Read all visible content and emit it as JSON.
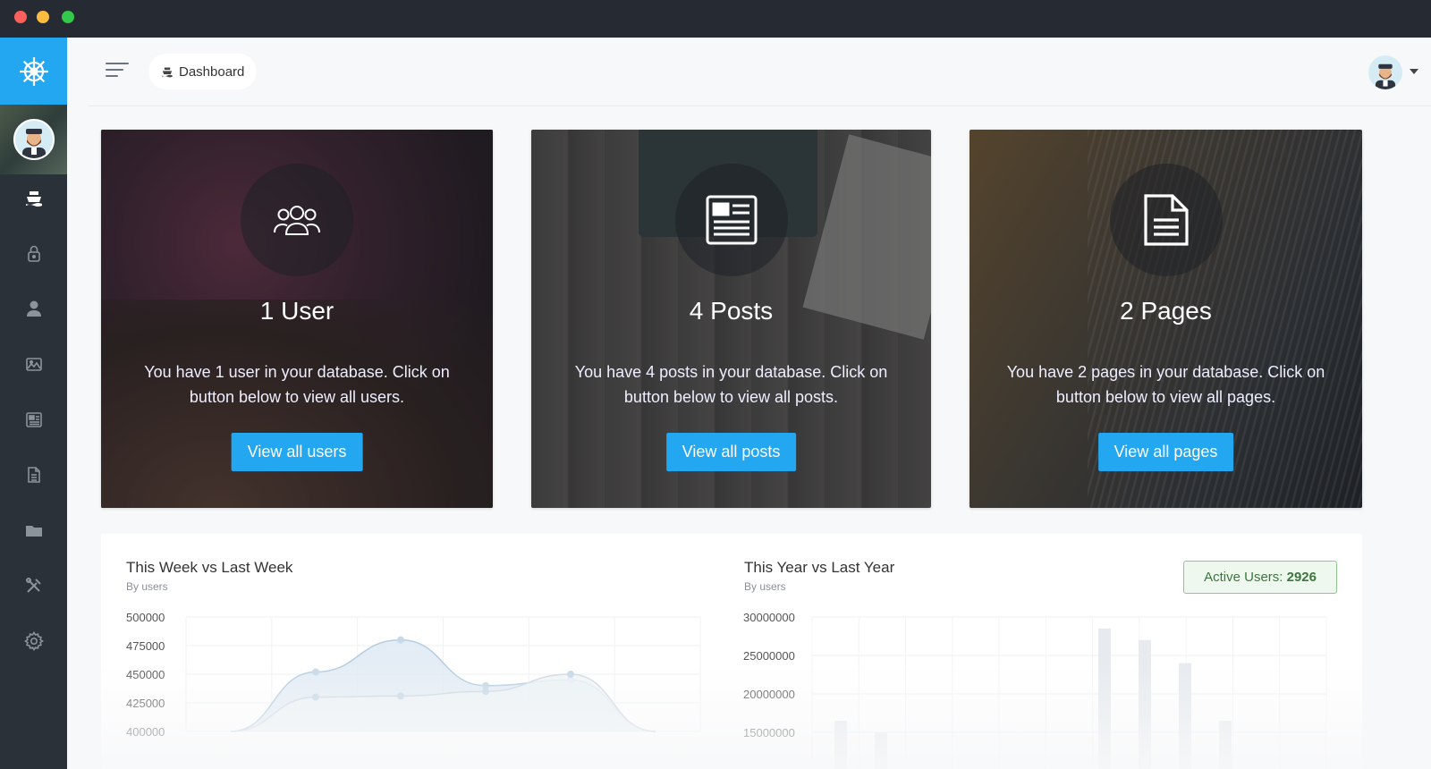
{
  "breadcrumb": {
    "label": "Dashboard"
  },
  "cards": [
    {
      "title": "1 User",
      "description": "You have 1 user in your database. Click on button below to view all users.",
      "button": "View all users"
    },
    {
      "title": "4 Posts",
      "description": "You have 4 posts in your database. Click on button below to view all posts.",
      "button": "View all posts"
    },
    {
      "title": "2 Pages",
      "description": "You have 2 pages in your database. Click on button below to view all pages.",
      "button": "View all pages"
    }
  ],
  "sidebar": {
    "items": [
      {
        "icon": "boat-icon"
      },
      {
        "icon": "lock-icon"
      },
      {
        "icon": "user-icon"
      },
      {
        "icon": "images-icon"
      },
      {
        "icon": "news-icon"
      },
      {
        "icon": "document-icon"
      },
      {
        "icon": "folder-icon"
      },
      {
        "icon": "tools-icon"
      },
      {
        "icon": "gear-icon"
      }
    ]
  },
  "charts": {
    "week": {
      "title": "This Week vs Last Week",
      "subtitle": "By users"
    },
    "year": {
      "title": "This Year vs Last Year",
      "subtitle": "By users"
    },
    "active_users_label": "Active Users:",
    "active_users_value": "2926"
  },
  "chart_data": [
    {
      "type": "area",
      "title": "This Week vs Last Week",
      "ylabel": "",
      "yticks": [
        "500000",
        "475000",
        "450000",
        "425000",
        "400000"
      ],
      "ylim": [
        400000,
        500000
      ],
      "series": [
        {
          "values": [
            400000,
            452000,
            480000,
            440000,
            445000,
            400000
          ]
        },
        {
          "values": [
            400000,
            430000,
            431000,
            435000,
            450000,
            400000
          ]
        }
      ]
    },
    {
      "type": "bar",
      "title": "This Year vs Last Year",
      "ylabel": "",
      "yticks": [
        "30000000",
        "25000000",
        "20000000",
        "15000000"
      ],
      "ylim": [
        15000000,
        30000000
      ],
      "values": [
        16500000,
        15000000,
        28500000,
        27000000,
        24000000,
        16500000
      ]
    }
  ],
  "colors": {
    "accent": "#22a7f0",
    "sidebar": "#2a3138",
    "success": "#3c763d"
  }
}
